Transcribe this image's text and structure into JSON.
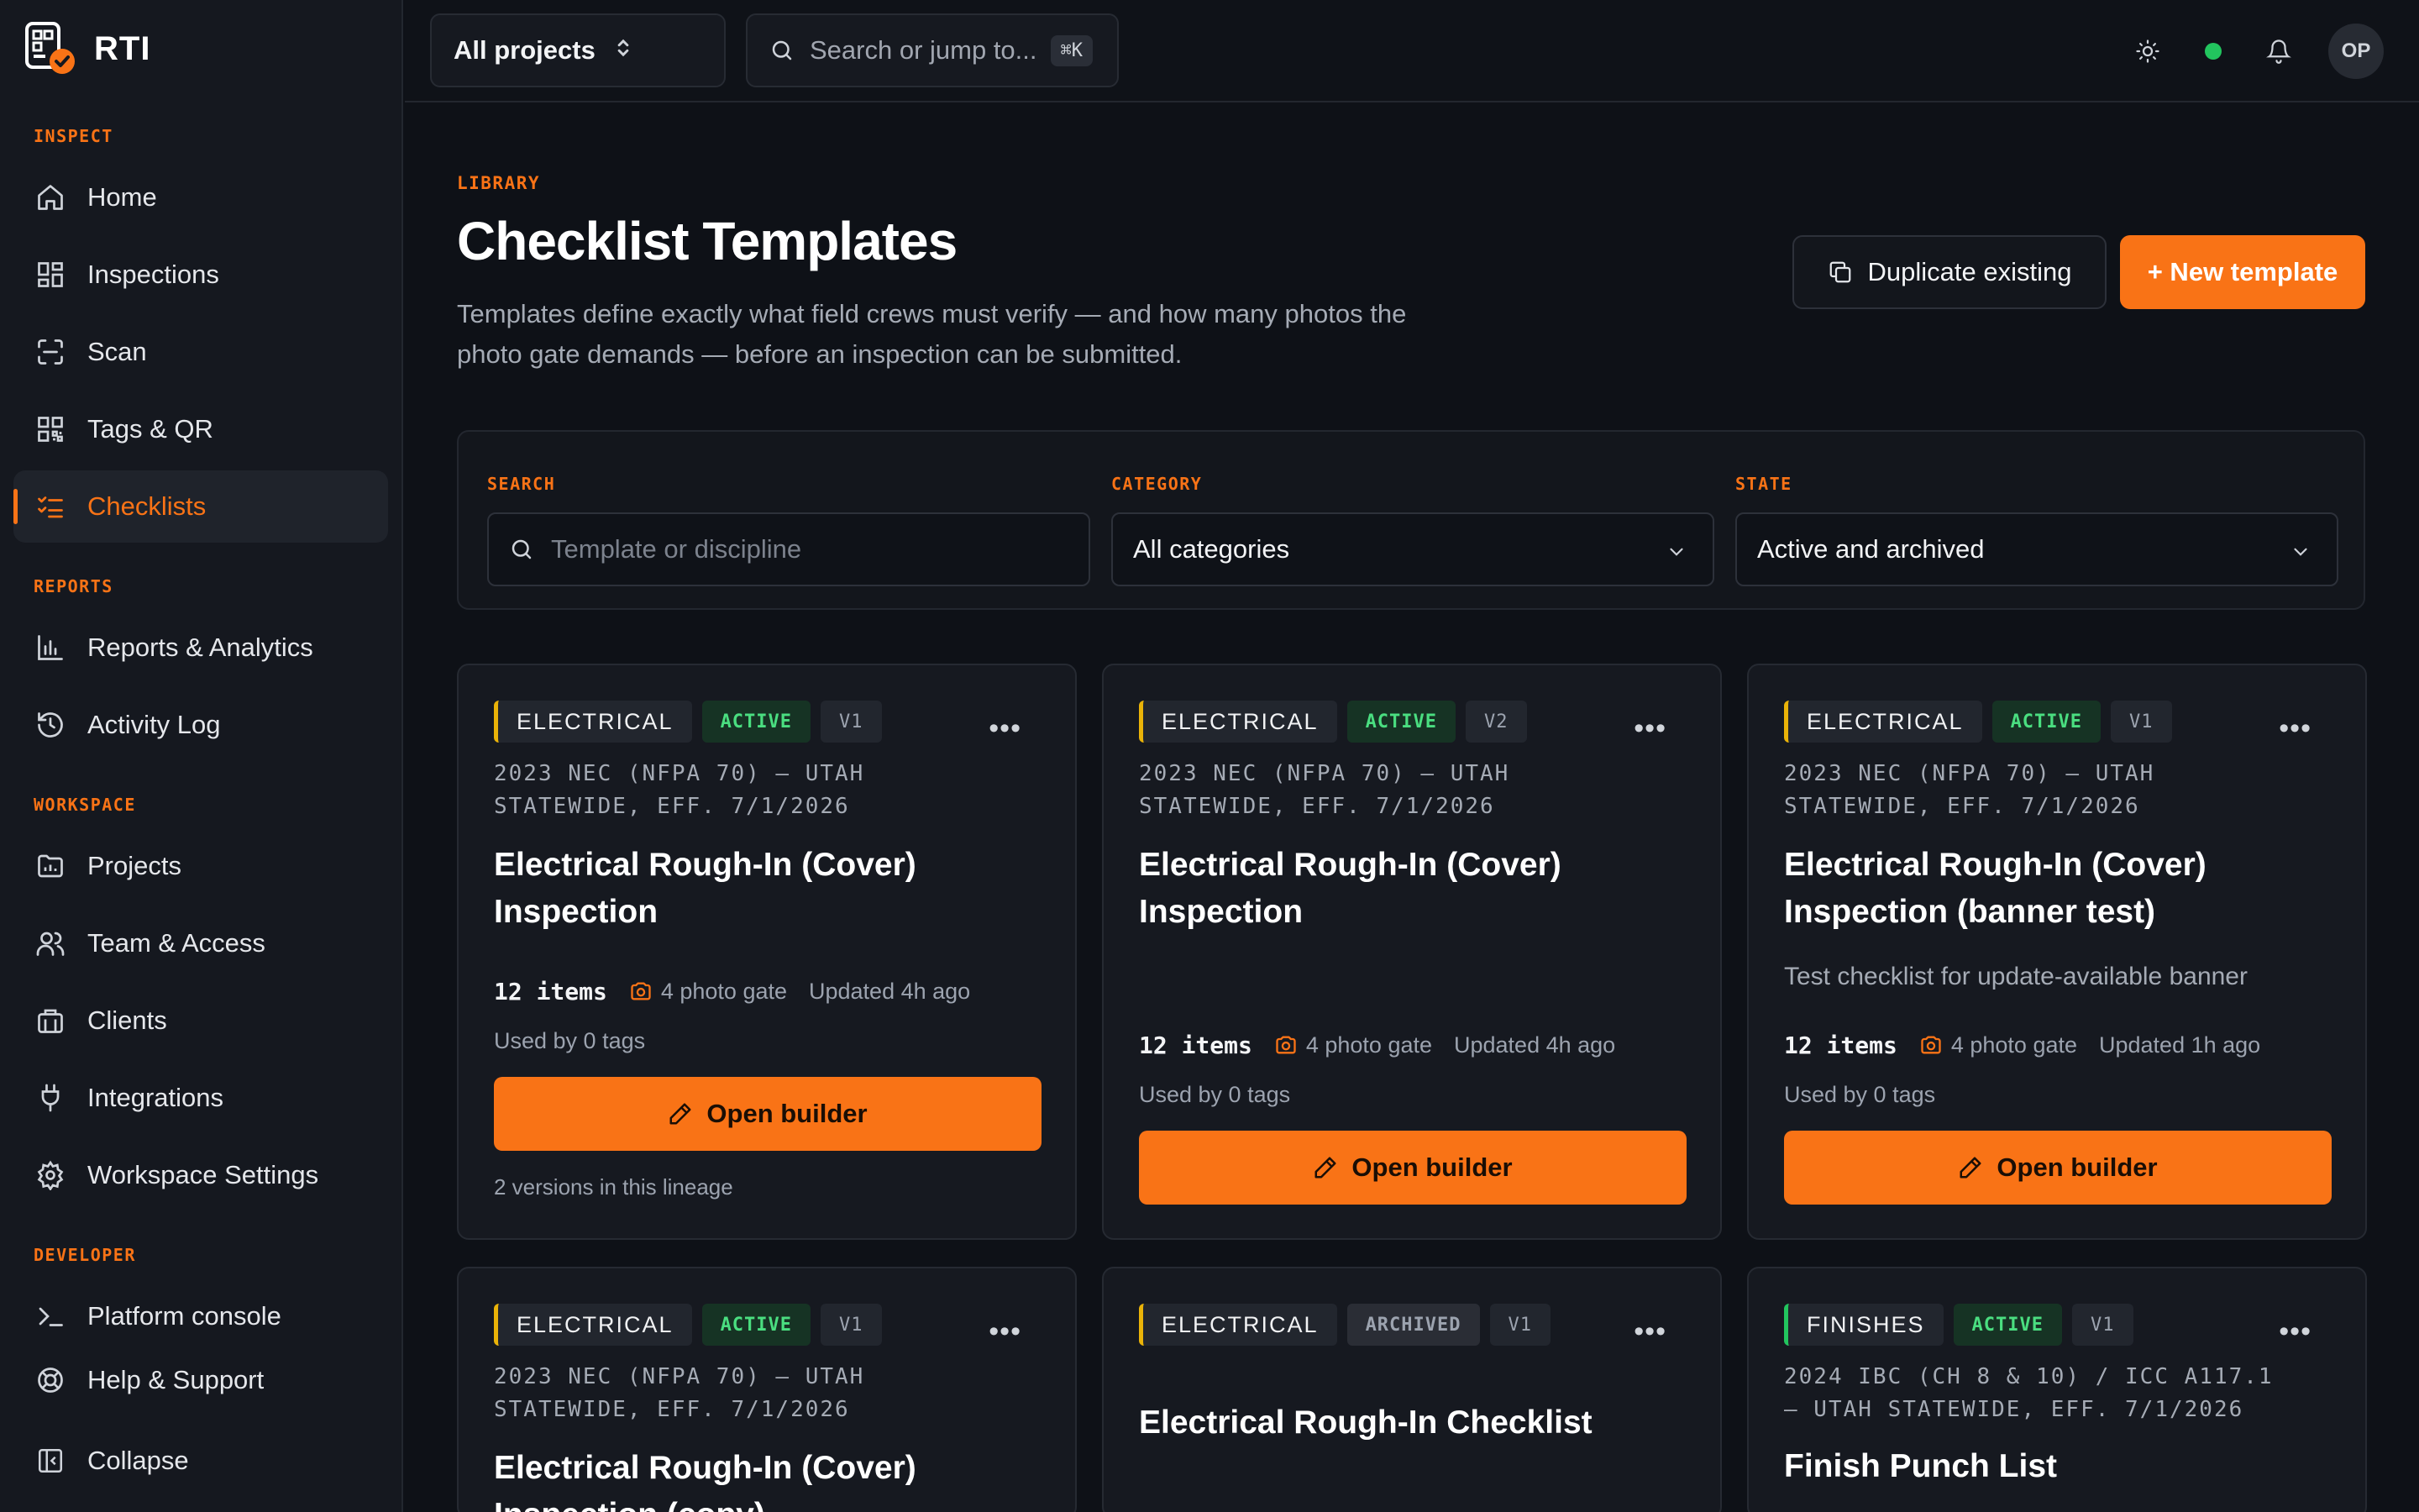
{
  "app": {
    "name": "RTI"
  },
  "sidebar": {
    "sections": {
      "inspect": "INSPECT",
      "reports": "REPORTS",
      "workspace": "WORKSPACE",
      "developer": "DEVELOPER"
    },
    "items": {
      "home": "Home",
      "inspections": "Inspections",
      "scan": "Scan",
      "tags": "Tags & QR",
      "checklists": "Checklists",
      "reports": "Reports & Analytics",
      "activity": "Activity Log",
      "projects": "Projects",
      "team": "Team & Access",
      "clients": "Clients",
      "integrations": "Integrations",
      "settings": "Workspace Settings",
      "console": "Platform console",
      "help": "Help & Support",
      "collapse": "Collapse"
    },
    "active": "checklists"
  },
  "topbar": {
    "project_select": "All projects",
    "search_placeholder": "Search or jump to...",
    "search_shortcut": "⌘K",
    "avatar_initials": "OP",
    "status_color": "#22c55e"
  },
  "page": {
    "eyebrow": "LIBRARY",
    "title": "Checklist Templates",
    "description": "Templates define exactly what field crews must verify — and how many photos the photo gate demands — before an inspection can be submitted.",
    "duplicate_label": "Duplicate existing",
    "new_label": "+ New template"
  },
  "filters": {
    "search": {
      "label": "SEARCH",
      "placeholder": "Template or discipline"
    },
    "category": {
      "label": "CATEGORY",
      "value": "All categories"
    },
    "state": {
      "label": "STATE",
      "value": "Active and archived"
    }
  },
  "cards": [
    {
      "category": "ELECTRICAL",
      "state": "ACTIVE",
      "version": "V1",
      "code": "2023 NEC (NFPA 70) — UTAH STATEWIDE, EFF. 7/1/2026",
      "title": "Electrical Rough-In (Cover) Inspection",
      "description": "",
      "items": "12 items",
      "photo_gate": "4 photo gate",
      "updated": "Updated 4h ago",
      "used_by": "Used by 0 tags",
      "button": "Open builder",
      "lineage": "2 versions in this lineage"
    },
    {
      "category": "ELECTRICAL",
      "state": "ACTIVE",
      "version": "V2",
      "code": "2023 NEC (NFPA 70) — UTAH STATEWIDE, EFF. 7/1/2026",
      "title": "Electrical Rough-In (Cover) Inspection",
      "description": "",
      "items": "12 items",
      "photo_gate": "4 photo gate",
      "updated": "Updated 4h ago",
      "used_by": "Used by 0 tags",
      "button": "Open builder"
    },
    {
      "category": "ELECTRICAL",
      "state": "ACTIVE",
      "version": "V1",
      "code": "2023 NEC (NFPA 70) — UTAH STATEWIDE, EFF. 7/1/2026",
      "title": "Electrical Rough-In (Cover) Inspection (banner test)",
      "description": "Test checklist for update-available banner",
      "items": "12 items",
      "photo_gate": "4 photo gate",
      "updated": "Updated 1h ago",
      "used_by": "Used by 0 tags",
      "button": "Open builder"
    },
    {
      "category": "ELECTRICAL",
      "state": "ACTIVE",
      "version": "V1",
      "code": "2023 NEC (NFPA 70) — UTAH STATEWIDE, EFF. 7/1/2026",
      "title": "Electrical Rough-In (Cover) Inspection (copy)"
    },
    {
      "category": "ELECTRICAL",
      "state": "ARCHIVED",
      "version": "V1",
      "code": "",
      "title": "Electrical Rough-In Checklist"
    },
    {
      "category": "FINISHES",
      "state": "ACTIVE",
      "version": "V1",
      "code": "2024 IBC (CH 8 & 10) / ICC A117.1 — UTAH STATEWIDE, EFF. 7/1/2026",
      "title": "Finish Punch List"
    }
  ],
  "colors": {
    "accent": "#f97316",
    "active_badge": "#4ade80",
    "electrical": "#eab308",
    "finishes": "#22c55e"
  }
}
